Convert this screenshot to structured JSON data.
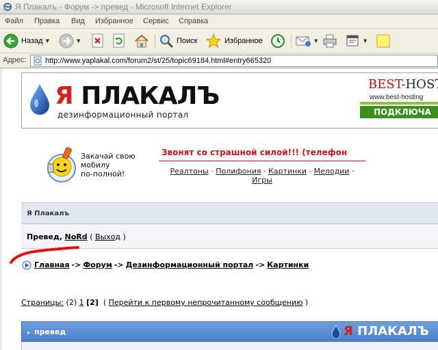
{
  "window": {
    "title": "Я Плакалъ - Форум -> превед - Microsoft Internet Explorer"
  },
  "menu": {
    "items": [
      "Файл",
      "Правка",
      "Вид",
      "Избранное",
      "Сервис",
      "Справка"
    ]
  },
  "toolbar": {
    "back_label": "Назад",
    "search_label": "Поиск",
    "favorites_label": "Избранное"
  },
  "address": {
    "label": "Адрес:",
    "url": "http://www.yaplakal.com/forum2/st/25/topic69184.html#entry665320"
  },
  "header": {
    "logo_ya": "Я",
    "logo_rest": "ПЛАКАЛЪ",
    "subtitle": "дезинформационный портал",
    "ad_best": "BEST",
    "ad_dash": "-",
    "ad_hosting": "HOSTIN",
    "ad_url": "www.best-hosting",
    "ad_cta": "ПОДКЛЮЧА"
  },
  "promo": {
    "text_line1": "Закачай свою",
    "text_line2": "мобилу",
    "text_line3": "по-полной!",
    "headline": "Звонят со страшной силой!!! (телефон",
    "links": [
      "Реалтоны",
      "Полифония",
      "Картинки",
      "Мелодии",
      "Игры"
    ],
    "separator": "·"
  },
  "forum": {
    "board_title": "Я Плакалъ",
    "greeting_prefix": "Превед,",
    "username": "NoRd",
    "logout": "Выход",
    "paren_open": "(",
    "paren_close": ")"
  },
  "breadcrumb": {
    "items": [
      "Главная",
      "Форум",
      "Дезинформационный портал",
      "Картинки"
    ],
    "arrow": "->"
  },
  "pagination": {
    "label": "Страницы:",
    "total": "(2)",
    "page1": "1",
    "current": "[2]",
    "goto_unread": "Перейти к первому непрочитанному сообщению"
  },
  "topic": {
    "title": "превед",
    "logo_ya": "Я",
    "logo_rest": "ПЛАКАЛЪ"
  },
  "colors": {
    "brand_red": "#d4211b",
    "topic_blue": "#4a7fca",
    "ad_green": "#3a8f1f"
  }
}
